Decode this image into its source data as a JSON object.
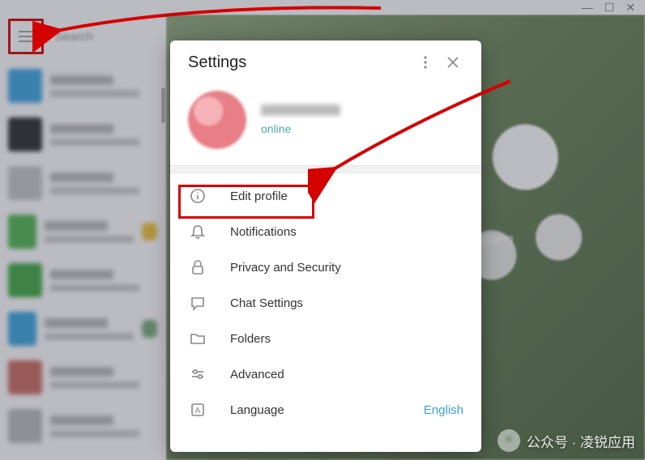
{
  "window": {
    "search_placeholder": "Search"
  },
  "panel": {
    "title": "Settings",
    "status": "online",
    "items": [
      {
        "label": "Edit profile"
      },
      {
        "label": "Notifications"
      },
      {
        "label": "Privacy and Security"
      },
      {
        "label": "Chat Settings"
      },
      {
        "label": "Folders"
      },
      {
        "label": "Advanced"
      },
      {
        "label": "Language",
        "value": "English"
      }
    ]
  },
  "background_chip": "ssaging",
  "watermark": "公众号 · 凌锐应用"
}
